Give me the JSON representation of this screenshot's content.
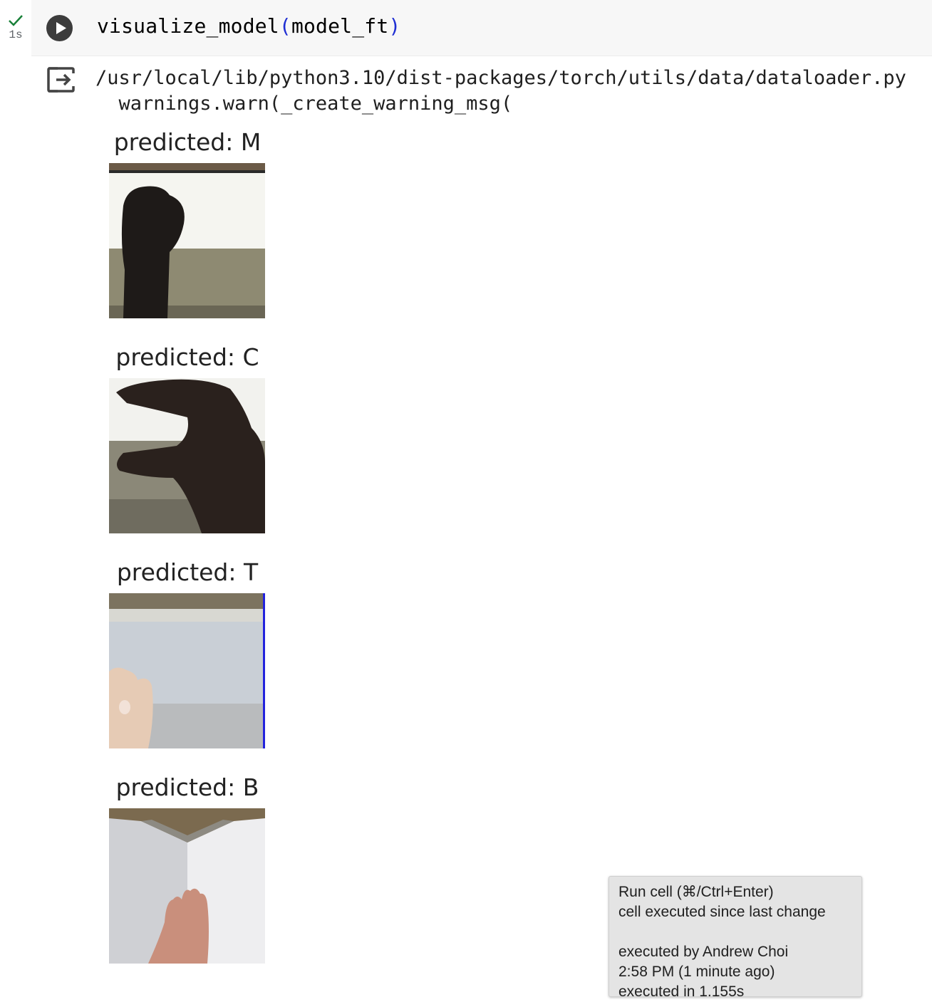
{
  "cell": {
    "status_icon": "checkmark-icon",
    "exec_time": "1s",
    "run_icon": "play-icon",
    "code_fn": "visualize_model",
    "code_open": "(",
    "code_arg": "model_ft",
    "code_close": ")"
  },
  "output": {
    "icon": "output-redirect-icon",
    "stderr_line1": "/usr/local/lib/python3.10/dist-packages/torch/utils/data/dataloader.py",
    "stderr_line2": "  warnings.warn(_create_warning_msg(",
    "plots": [
      {
        "title": "predicted: M",
        "image": "fist hand sign photo"
      },
      {
        "title": "predicted: C",
        "image": "c hand sign photo"
      },
      {
        "title": "predicted: T",
        "image": "t hand sign photo"
      },
      {
        "title": "predicted: B",
        "image": "b hand sign photo"
      }
    ]
  },
  "tooltip": {
    "line1": "Run cell (⌘/Ctrl+Enter)",
    "line2": "cell executed since last change",
    "line3": "",
    "line4": "executed by Andrew Choi",
    "line5": "2:58 PM (1 minute ago)",
    "line6": "executed in 1.155s"
  },
  "colors": {
    "check": "#188038",
    "paren": "#1f2fd3",
    "cell_bg": "#f7f7f7",
    "tooltip_bg": "#e4e4e4"
  }
}
